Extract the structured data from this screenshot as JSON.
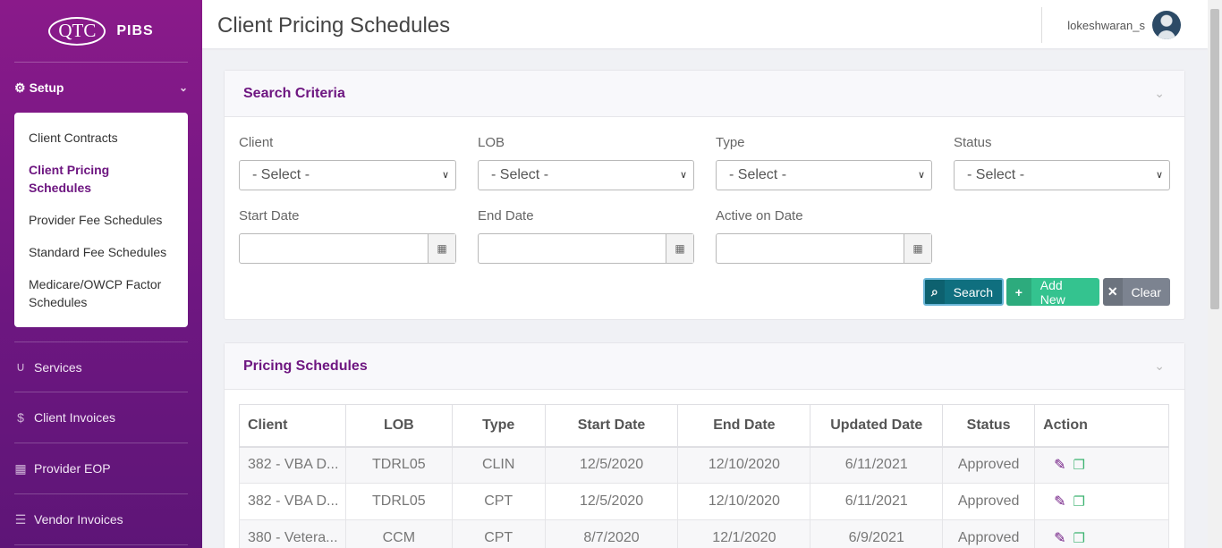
{
  "sidebar": {
    "logo_left": "QTC",
    "logo_right": "PIBS",
    "setup_label": "Setup",
    "sub_items": [
      {
        "label": "Client Contracts"
      },
      {
        "label": "Client Pricing Schedules"
      },
      {
        "label": "Provider Fee Schedules"
      },
      {
        "label": "Standard Fee Schedules"
      },
      {
        "label": "Medicare/OWCP Factor Schedules"
      }
    ],
    "nav_items": [
      {
        "label": "Services",
        "icon": "stethoscope-icon"
      },
      {
        "label": "Client Invoices",
        "icon": "dollar-icon"
      },
      {
        "label": "Provider EOP",
        "icon": "calendar-icon"
      },
      {
        "label": "Vendor Invoices",
        "icon": "list-icon"
      }
    ]
  },
  "header": {
    "title": "Client Pricing Schedules",
    "username": "lokeshwaran_s"
  },
  "search": {
    "title": "Search Criteria",
    "client_label": "Client",
    "client_value": "- Select -",
    "lob_label": "LOB",
    "lob_value": "- Select -",
    "type_label": "Type",
    "type_value": "- Select -",
    "status_label": "Status",
    "status_value": "- Select -",
    "start_label": "Start Date",
    "end_label": "End Date",
    "active_label": "Active on Date",
    "search_btn": "Search",
    "add_btn": "Add New",
    "clear_btn": "Clear"
  },
  "schedules": {
    "title": "Pricing Schedules",
    "columns": [
      "Client",
      "LOB",
      "Type",
      "Start Date",
      "End Date",
      "Updated Date",
      "Status",
      "Action"
    ],
    "rows": [
      {
        "client": "382 - VBA D...",
        "lob": "TDRL05",
        "type": "CLIN",
        "start": "12/5/2020",
        "end": "12/10/2020",
        "updated": "6/11/2021",
        "status": "Approved"
      },
      {
        "client": "382 - VBA D...",
        "lob": "TDRL05",
        "type": "CPT",
        "start": "12/5/2020",
        "end": "12/10/2020",
        "updated": "6/11/2021",
        "status": "Approved"
      },
      {
        "client": "380 - Vetera...",
        "lob": "CCM",
        "type": "CPT",
        "start": "8/7/2020",
        "end": "12/1/2020",
        "updated": "6/9/2021",
        "status": "Approved"
      }
    ]
  },
  "colors": {
    "brand": "#6e1781",
    "search_btn": "#0f6f7f",
    "add_btn": "#34c38f",
    "clear_btn": "#7c8390"
  }
}
